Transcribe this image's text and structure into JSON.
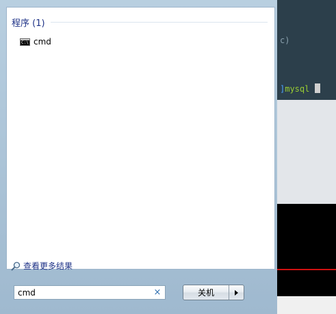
{
  "background": {
    "terminal_fragment": "c)",
    "prompt_bracket": "]",
    "prompt_text": "mysql"
  },
  "start_menu": {
    "section_title": "程序 (1)",
    "results": [
      {
        "label": "cmd",
        "icon": "cmd-icon"
      }
    ],
    "see_more_label": "查看更多结果",
    "search": {
      "value": "cmd",
      "clear_glyph": "×"
    },
    "shutdown": {
      "label": "关机"
    }
  },
  "colors": {
    "section_title": "#1e3287",
    "menu_frame": "#b8cfe0",
    "terminal_prompt": "#9acd32",
    "accent_red": "#d01010"
  }
}
